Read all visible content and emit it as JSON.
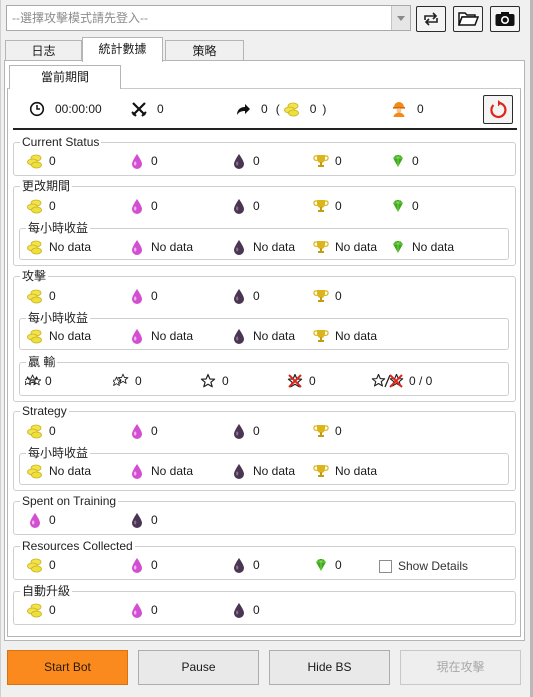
{
  "toolbar": {
    "mode_placeholder": "--選擇攻擊模式請先登入--",
    "icons": [
      "refresh-arrows-icon",
      "folder-open-icon",
      "camera-icon"
    ]
  },
  "tabs": [
    "日志",
    "統計數據",
    "策略"
  ],
  "active_tab": "統計數據",
  "subtab": "當前期間",
  "summary": {
    "time": "00:00:00",
    "attacks": "0",
    "skipped": "0",
    "skipped_gold": "0",
    "builder": "0",
    "paren_open": "(",
    "paren_close": ")"
  },
  "sections": {
    "current_status": {
      "label": "Current Status",
      "gold": "0",
      "elixir": "0",
      "dark": "0",
      "trophy": "0",
      "gem": "0"
    },
    "change_period": {
      "label": "更改期間",
      "gold": "0",
      "elixir": "0",
      "dark": "0",
      "trophy": "0",
      "gem": "0",
      "hourly": {
        "label": "每小時收益",
        "gold": "No data",
        "elixir": "No data",
        "dark": "No data",
        "trophy": "No data",
        "gem": "No data"
      }
    },
    "attack": {
      "label": "攻擊",
      "gold": "0",
      "elixir": "0",
      "dark": "0",
      "trophy": "0",
      "hourly": {
        "label": "每小時收益",
        "gold": "No data",
        "elixir": "No data",
        "dark": "No data",
        "trophy": "No data"
      },
      "win_loss": {
        "label": "贏 輸",
        "stars3": "0",
        "stars2": "0",
        "stars1": "0",
        "stars0": "0",
        "ratio": "0 / 0"
      }
    },
    "strategy": {
      "label": "Strategy",
      "gold": "0",
      "elixir": "0",
      "dark": "0",
      "trophy": "0",
      "hourly": {
        "label": "每小時收益",
        "gold": "No data",
        "elixir": "No data",
        "dark": "No data",
        "trophy": "No data"
      }
    },
    "training": {
      "label": "Spent on Training",
      "elixir": "0",
      "dark": "0"
    },
    "collected": {
      "label": "Resources Collected",
      "gold": "0",
      "elixir": "0",
      "dark": "0",
      "gem": "0",
      "show_details": "Show Details"
    },
    "upgrade": {
      "label": "自動升級",
      "gold": "0",
      "elixir": "0",
      "dark": "0"
    }
  },
  "buttons": {
    "start": "Start Bot",
    "pause": "Pause",
    "hide": "Hide BS",
    "attack_now": "現在攻擊"
  },
  "colors": {
    "gold": "#e8d33c",
    "elixir": "#d34fd2",
    "dark": "#4a3552",
    "trophy": "#d8b21a",
    "gem": "#3ca81c",
    "start": "#fa8a1e",
    "reset": "#e0241c"
  }
}
